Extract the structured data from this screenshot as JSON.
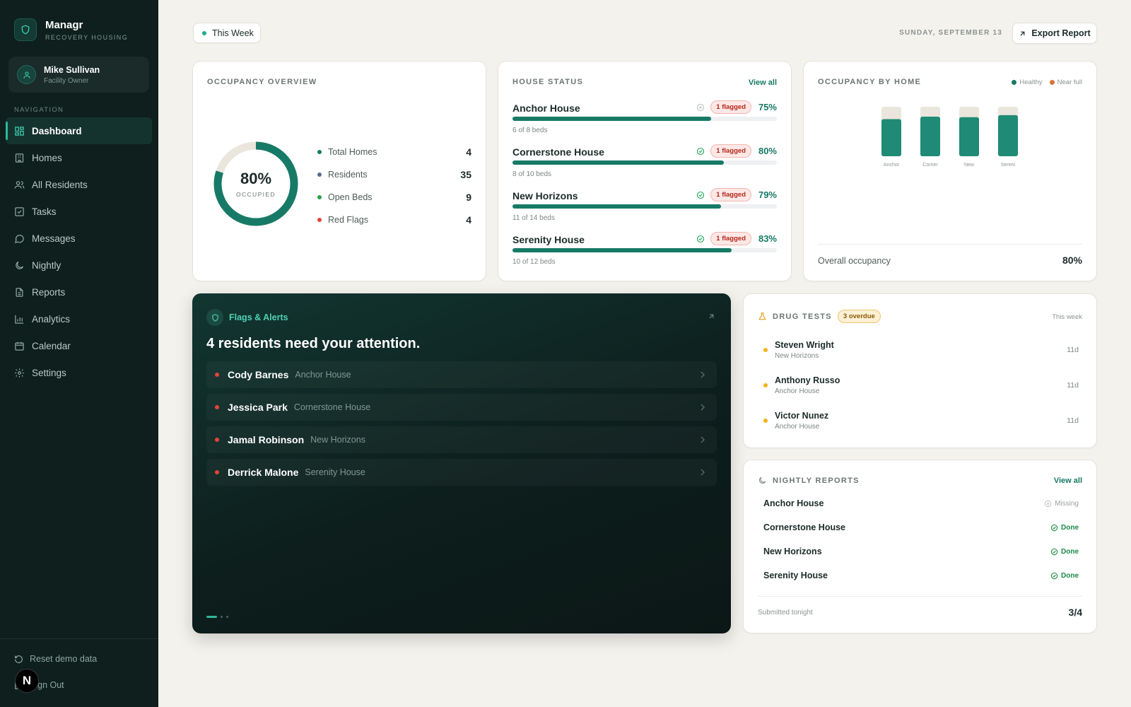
{
  "brand": {
    "name": "Managr",
    "subtitle": "RECOVERY HOUSING"
  },
  "user": {
    "name": "Mike Sullivan",
    "role": "Facility Owner"
  },
  "nav": {
    "heading": "NAVIGATION",
    "items": [
      {
        "label": "Dashboard",
        "icon": "dashboard-icon",
        "active": true
      },
      {
        "label": "Homes",
        "icon": "building-icon"
      },
      {
        "label": "All Residents",
        "icon": "users-icon"
      },
      {
        "label": "Tasks",
        "icon": "check-square-icon"
      },
      {
        "label": "Messages",
        "icon": "message-icon"
      },
      {
        "label": "Nightly",
        "icon": "moon-icon"
      },
      {
        "label": "Reports",
        "icon": "file-icon"
      },
      {
        "label": "Analytics",
        "icon": "bar-chart-icon"
      },
      {
        "label": "Calendar",
        "icon": "calendar-icon"
      },
      {
        "label": "Settings",
        "icon": "gear-icon"
      }
    ],
    "reset": "Reset demo data",
    "signout": "Sign Out",
    "badge": "N"
  },
  "topbar": {
    "week": "This Week",
    "date": "SUNDAY, SEPTEMBER 13",
    "export": "Export Report"
  },
  "occupancy": {
    "title": "OCCUPANCY OVERVIEW",
    "percent": "80%",
    "percent_value": 0.8,
    "label": "OCCUPIED",
    "stats": [
      {
        "label": "Total Homes",
        "value": "4",
        "color": "#177a66"
      },
      {
        "label": "Residents",
        "value": "35",
        "color": "#5b6b8c"
      },
      {
        "label": "Open Beds",
        "value": "9",
        "color": "#2aa14b"
      },
      {
        "label": "Red Flags",
        "value": "4",
        "color": "#e5443a"
      }
    ]
  },
  "house_status": {
    "title": "HOUSE STATUS",
    "view_all": "View all",
    "houses": [
      {
        "name": "Anchor House",
        "flag": "1 flagged",
        "pct": "75%",
        "fill": 0.75,
        "beds": "6 of 8 beds",
        "icon": "circle-x-icon"
      },
      {
        "name": "Cornerstone House",
        "flag": "1 flagged",
        "pct": "80%",
        "fill": 0.8,
        "beds": "8 of 10 beds",
        "icon": "circle-check-icon"
      },
      {
        "name": "New Horizons",
        "flag": "1 flagged",
        "pct": "79%",
        "fill": 0.79,
        "beds": "11 of 14 beds",
        "icon": "circle-check-icon"
      },
      {
        "name": "Serenity House",
        "flag": "1 flagged",
        "pct": "83%",
        "fill": 0.83,
        "beds": "10 of 12 beds",
        "icon": "circle-check-icon"
      }
    ]
  },
  "occupancy_by_home": {
    "title": "OCCUPANCY BY HOME",
    "legend": [
      {
        "label": "Healthy",
        "color": "#177a66"
      },
      {
        "label": "Near full",
        "color": "#d9733a"
      }
    ],
    "footer_label": "Overall occupancy",
    "footer_value": "80%"
  },
  "chart_data": {
    "type": "bar",
    "categories": [
      "Anchor",
      "Corner",
      "New",
      "Sereni"
    ],
    "values": [
      75,
      80,
      79,
      83
    ],
    "ylim": [
      0,
      100
    ],
    "title": "",
    "xlabel": "",
    "ylabel": "",
    "grid": false,
    "legend": "top-right",
    "color": "#1f8a75",
    "track_color": "#ebe6dd"
  },
  "flags": {
    "label": "Flags & Alerts",
    "title": "4 residents need your attention.",
    "alerts": [
      {
        "name": "Cody Barnes",
        "house": "Anchor House"
      },
      {
        "name": "Jessica Park",
        "house": "Cornerstone House"
      },
      {
        "name": "Jamal Robinson",
        "house": "New Horizons"
      },
      {
        "name": "Derrick Malone",
        "house": "Serenity House"
      }
    ]
  },
  "drug_tests": {
    "title": "DRUG TESTS",
    "badge": "3 overdue",
    "period": "This week",
    "items": [
      {
        "name": "Steven Wright",
        "house": "New Horizons",
        "days": "11d"
      },
      {
        "name": "Anthony Russo",
        "house": "Anchor House",
        "days": "11d"
      },
      {
        "name": "Victor Nunez",
        "house": "Anchor House",
        "days": "11d"
      }
    ]
  },
  "nightly": {
    "title": "NIGHTLY REPORTS",
    "view_all": "View all",
    "items": [
      {
        "name": "Anchor House",
        "status": "Missing",
        "done": false
      },
      {
        "name": "Cornerstone House",
        "status": "Done",
        "done": true
      },
      {
        "name": "New Horizons",
        "status": "Done",
        "done": true
      },
      {
        "name": "Serenity House",
        "status": "Done",
        "done": true
      }
    ],
    "footer_label": "Submitted tonight",
    "footer_value": "3/4"
  }
}
